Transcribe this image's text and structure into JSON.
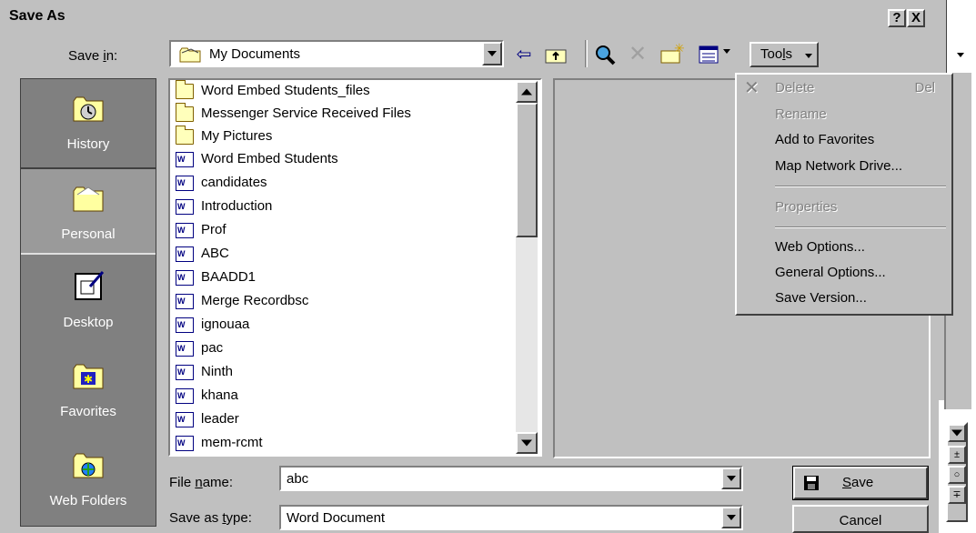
{
  "window": {
    "title": "Save As",
    "help_btn": "?",
    "close_btn": "X"
  },
  "toolbar": {
    "save_in_label": "Save in:",
    "save_in_value": "My Documents",
    "tools_label": "Tools"
  },
  "places": [
    {
      "label": "History"
    },
    {
      "label": "Personal"
    },
    {
      "label": "Desktop"
    },
    {
      "label": "Favorites"
    },
    {
      "label": "Web Folders"
    }
  ],
  "files": [
    {
      "name": "Word Embed Students_files",
      "type": "folder"
    },
    {
      "name": "Messenger Service Received Files",
      "type": "folder"
    },
    {
      "name": "My Pictures",
      "type": "folder"
    },
    {
      "name": "Word Embed Students",
      "type": "doc"
    },
    {
      "name": "candidates",
      "type": "doc"
    },
    {
      "name": "Introduction",
      "type": "doc"
    },
    {
      "name": "Prof",
      "type": "doc"
    },
    {
      "name": "ABC",
      "type": "doc"
    },
    {
      "name": "BAADD1",
      "type": "doc"
    },
    {
      "name": "Merge Recordbsc",
      "type": "doc"
    },
    {
      "name": "ignouaa",
      "type": "doc"
    },
    {
      "name": "pac",
      "type": "doc"
    },
    {
      "name": "Ninth",
      "type": "doc"
    },
    {
      "name": "khana",
      "type": "doc"
    },
    {
      "name": "leader",
      "type": "doc"
    },
    {
      "name": "mem-rcmt",
      "type": "doc"
    }
  ],
  "bottom": {
    "file_name_label": "File name:",
    "file_name_value": "abc",
    "save_as_type_label": "Save as type:",
    "save_as_type_value": "Word Document",
    "save_label": "Save",
    "cancel_label": "Cancel"
  },
  "tools_menu": {
    "delete": "Delete",
    "delete_shortcut": "Del",
    "rename": "Rename",
    "add_to_favorites": "Add to Favorites",
    "map_network_drive": "Map Network Drive...",
    "properties": "Properties",
    "web_options": "Web Options...",
    "general_options": "General Options...",
    "save_version": "Save Version..."
  },
  "colors": {
    "dialog_bg": "#c0c0c0",
    "places_bg": "#808080",
    "disabled_text": "#808080"
  }
}
